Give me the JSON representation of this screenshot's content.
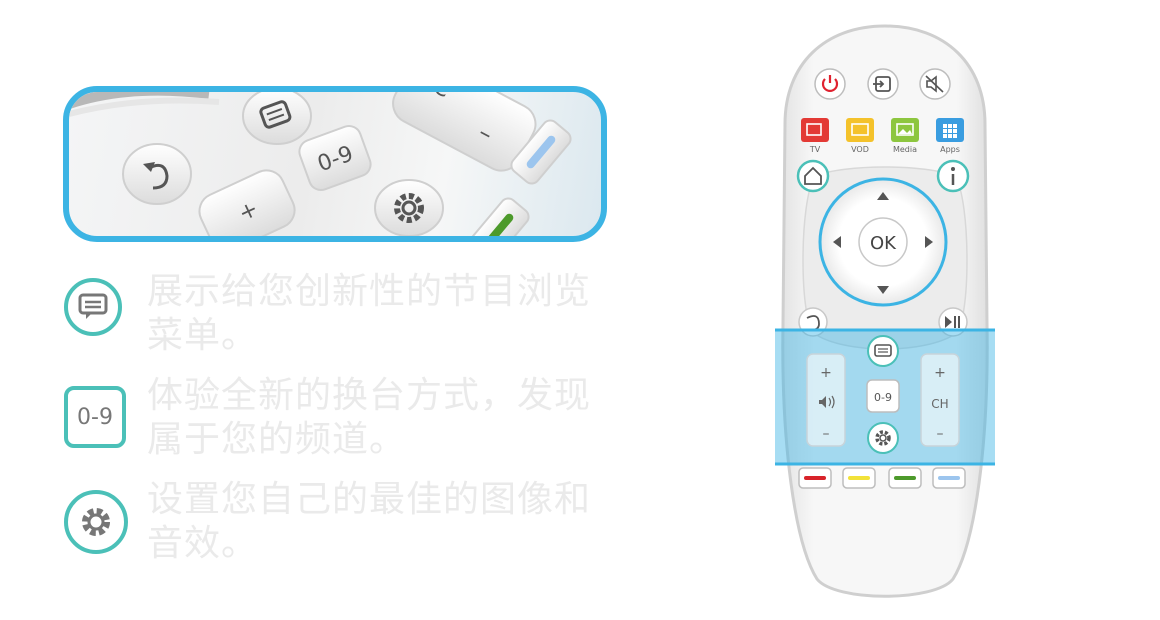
{
  "zoom_panel": {
    "key_09": "0-9",
    "key_plus": "+",
    "key_c": "C",
    "key_minus": "–"
  },
  "features": [
    {
      "icon": "menu-bubble-icon",
      "text": "展示给您创新性的节目浏览菜单。"
    },
    {
      "icon_text": "0-9",
      "text": "体验全新的换台方式，发现属于您的频道。"
    },
    {
      "icon": "gear-icon",
      "text": "设置您自己的最佳的图像和音效。"
    }
  ],
  "remote": {
    "source_labels": [
      "TV",
      "VOD",
      "Media",
      "Apps"
    ],
    "ok_label": "OK",
    "vol_plus": "+",
    "vol_minus": "–",
    "num_label": "0-9",
    "ch_plus": "+",
    "ch_label": "CH",
    "ch_minus": "–",
    "colors": {
      "power": "#e0212f",
      "tv": "#e33a35",
      "vod": "#f4c22b",
      "media": "#8dc63f",
      "apps": "#3a9de0",
      "accent": "#3cb4e4",
      "teal": "#4bc0b8",
      "red_key": "#d8232a",
      "yellow_key": "#f2e239",
      "green_key": "#4d9a2b",
      "blue_key": "#9cc5ee"
    }
  }
}
